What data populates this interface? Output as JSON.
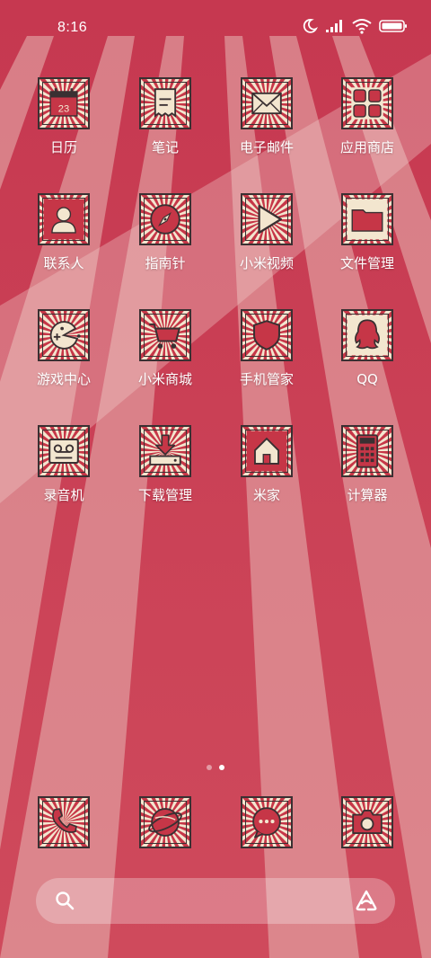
{
  "status_bar": {
    "time": "8:16"
  },
  "colors": {
    "background": "#c8384f",
    "tile_bg": "#f3e6cf",
    "tile_red": "#c63647",
    "tile_outline": "#3a3032",
    "label": "#ffffff"
  },
  "apps": [
    {
      "label": "日历",
      "icon": "calendar-icon",
      "badge": "23"
    },
    {
      "label": "笔记",
      "icon": "notes-icon"
    },
    {
      "label": "电子邮件",
      "icon": "email-icon"
    },
    {
      "label": "应用商店",
      "icon": "app-store-icon"
    },
    {
      "label": "联系人",
      "icon": "contacts-icon"
    },
    {
      "label": "指南针",
      "icon": "compass-icon"
    },
    {
      "label": "小米视频",
      "icon": "video-icon"
    },
    {
      "label": "文件管理",
      "icon": "folder-icon"
    },
    {
      "label": "游戏中心",
      "icon": "game-icon"
    },
    {
      "label": "小米商城",
      "icon": "shop-cart-icon"
    },
    {
      "label": "手机管家",
      "icon": "security-shield-icon"
    },
    {
      "label": "QQ",
      "icon": "qq-icon"
    },
    {
      "label": "录音机",
      "icon": "recorder-icon"
    },
    {
      "label": "下载管理",
      "icon": "download-icon"
    },
    {
      "label": "米家",
      "icon": "home-icon"
    },
    {
      "label": "计算器",
      "icon": "calculator-icon"
    }
  ],
  "dock": [
    {
      "icon": "phone-icon"
    },
    {
      "icon": "browser-icon"
    },
    {
      "icon": "messages-icon"
    },
    {
      "icon": "camera-icon"
    }
  ],
  "page_indicator": {
    "count": 2,
    "active": 2
  },
  "search_bar": {
    "left_icon": "search-icon",
    "right_icon": "assistant-icon"
  }
}
